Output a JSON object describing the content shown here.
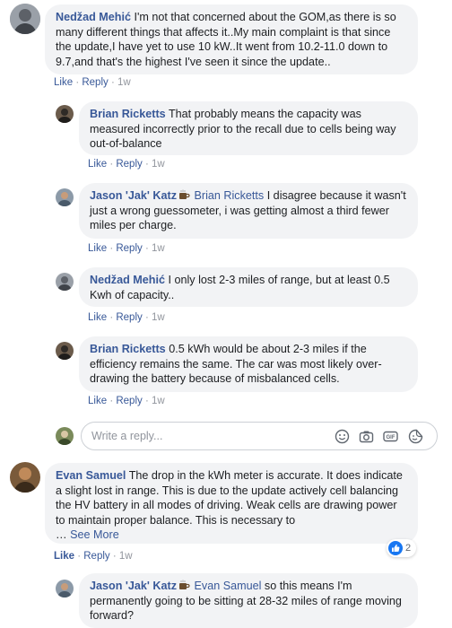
{
  "comments": [
    {
      "author": "Nedžad Mehić",
      "text": "I'm not that concerned about the GOM,as there is so many different things that affects it..My main complaint is that since the update,I have yet to use 10 kW..It went from 10.2-11.0 down to 9.7,and that's the highest I've seen it since the update..",
      "like": "Like",
      "reply": "Reply",
      "time": "1w"
    },
    {
      "author": "Brian Ricketts",
      "text": "That probably means the capacity was measured incorrectly prior to the recall due to cells being way out-of-balance",
      "like": "Like",
      "reply": "Reply",
      "time": "1w"
    },
    {
      "author": "Jason 'Jak' Katz",
      "mention": "Brian Ricketts",
      "text": "I disagree because it wasn't just a wrong guessometer, i was getting almost a third fewer miles per charge.",
      "like": "Like",
      "reply": "Reply",
      "time": "1w"
    },
    {
      "author": "Nedžad Mehić",
      "text": "I only lost 2-3 miles of range, but at least 0.5 Kwh of capacity..",
      "like": "Like",
      "reply": "Reply",
      "time": "1w"
    },
    {
      "author": "Brian Ricketts",
      "text": "0.5 kWh would be about 2-3 miles if the efficiency remains the same. The car was most likely over-drawing the battery because of misbalanced cells.",
      "like": "Like",
      "reply": "Reply",
      "time": "1w"
    },
    {
      "author": "Evan Samuel",
      "text": "The drop in the kWh meter is accurate. It does indicate a slight lost in range. This is due to the update actively cell balancing the HV battery in all modes of driving. Weak cells are drawing power to maintain proper balance. This is necessary to",
      "ellipsis": "…",
      "see_more": "See More",
      "like": "Like",
      "reply": "Reply",
      "time": "1w",
      "reaction_count": "2"
    },
    {
      "author": "Jason 'Jak' Katz",
      "mention": "Evan Samuel",
      "text": "so this means I'm permanently going to be sitting at 28-32 miles of range moving forward?"
    }
  ],
  "reply_box": {
    "placeholder": "Write a reply..."
  },
  "icons": [
    "emoji-icon",
    "camera-icon",
    "gif-icon",
    "sticker-icon",
    "coffee-icon",
    "like-reaction-icon"
  ],
  "colors": {
    "link": "#385898",
    "bubble": "#f2f3f5",
    "meta": "#90949c",
    "like_reaction": "#1877f2"
  }
}
